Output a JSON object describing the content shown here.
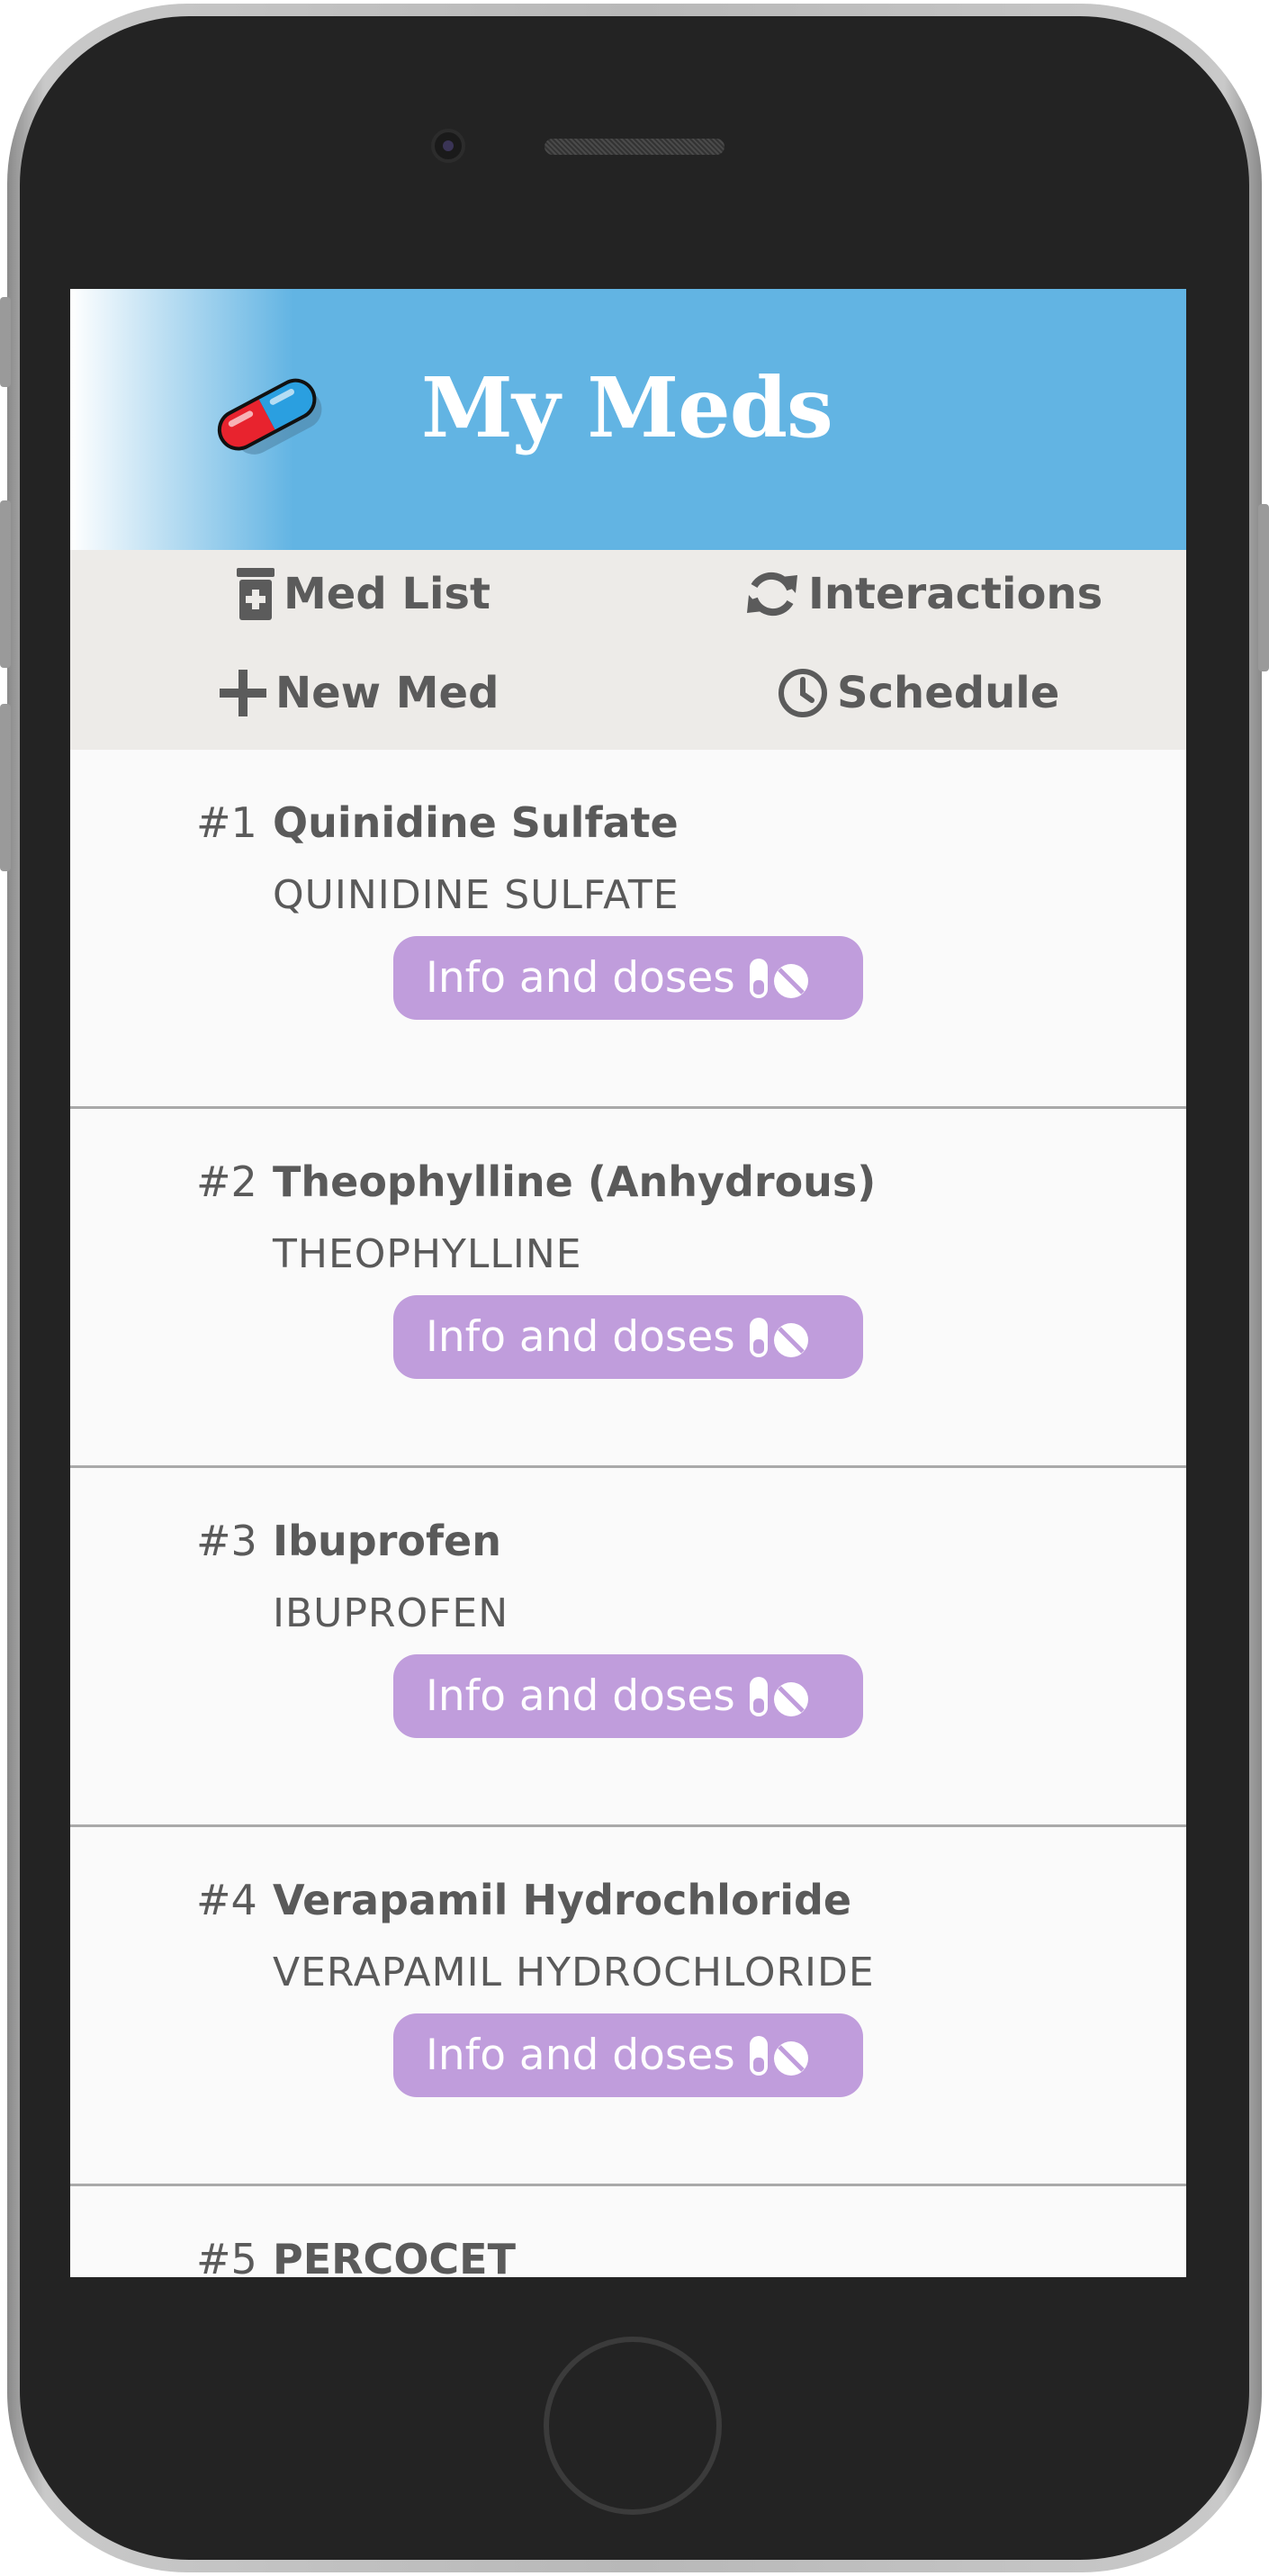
{
  "app": {
    "title": "My Meds",
    "logo_icon": "pill-capsule-icon",
    "colors": {
      "header": "#62b4e3",
      "nav_bg": "#edebe8",
      "button": "#c09ddc",
      "text": "#5a5a5a"
    }
  },
  "nav": {
    "med_list": "Med List",
    "interactions": "Interactions",
    "new_med": "New Med",
    "schedule": "Schedule"
  },
  "meds": [
    {
      "num": "#1",
      "name": "Quinidine Sulfate",
      "generic": "QUINIDINE SULFATE",
      "button": "Info and doses"
    },
    {
      "num": "#2",
      "name": "Theophylline (Anhydrous)",
      "generic": "THEOPHYLLINE",
      "button": "Info and doses"
    },
    {
      "num": "#3",
      "name": "Ibuprofen",
      "generic": "IBUPROFEN",
      "button": "Info and doses"
    },
    {
      "num": "#4",
      "name": "Verapamil Hydrochloride",
      "generic": "VERAPAMIL HYDROCHLORIDE",
      "button": "Info and doses"
    },
    {
      "num": "#5",
      "name": "PERCOCET",
      "generic": "",
      "button": ""
    }
  ]
}
